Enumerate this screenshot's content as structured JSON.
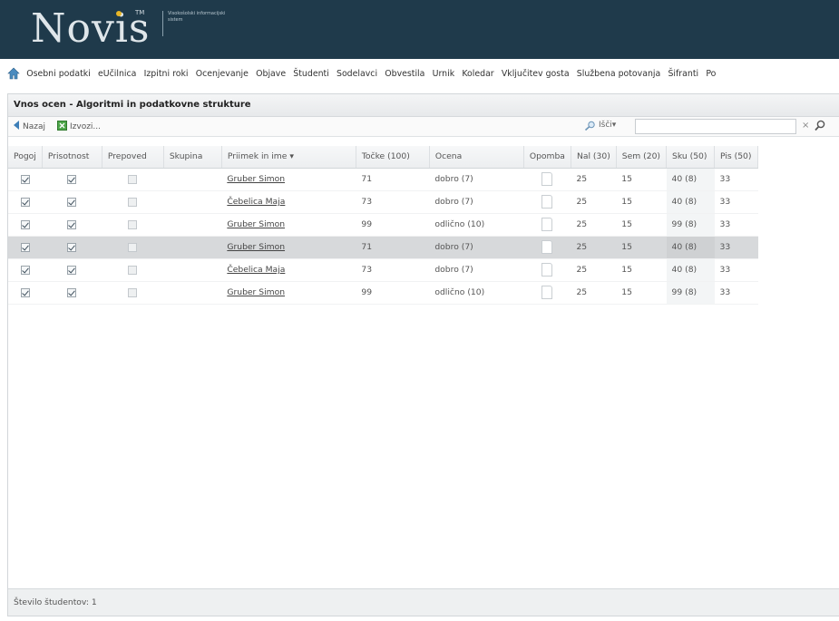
{
  "header": {
    "logo": "Novis",
    "trademark": "TM",
    "subtitle": "Visokošolski informacijski sistem"
  },
  "menu": {
    "items": [
      "Osebni podatki",
      "eUčilnica",
      "Izpitni roki",
      "Ocenjevanje",
      "Objave",
      "Študenti",
      "Sodelavci",
      "Obvestila",
      "Urnik",
      "Koledar",
      "Vključitev gosta",
      "Službena potovanja",
      "Šifranti",
      "Po"
    ]
  },
  "panel": {
    "title": "Vnos ocen - Algoritmi in podatkovne strukture"
  },
  "toolbar": {
    "back_label": "Nazaj",
    "export_label": "Izvozi...",
    "search_label": "Išči",
    "search_value": "",
    "clear_glyph": "×"
  },
  "table": {
    "columns": [
      "Pogoj",
      "Prisotnost",
      "Prepoved",
      "Skupina",
      "Priimek in ime ▾",
      "Točke (100)",
      "Ocena",
      "Opomba",
      "Nal (30)",
      "Sem (20)",
      "Sku (50)",
      "Pis (50)"
    ],
    "rows": [
      {
        "pogoj": true,
        "prisotnost": true,
        "prepoved": false,
        "skupina": "",
        "name": "Gruber Simon",
        "tocke": "71",
        "ocena": "dobro (7)",
        "nal": "25",
        "sem": "15",
        "sku": "40 (8)",
        "pis": "33",
        "selected": false
      },
      {
        "pogoj": true,
        "prisotnost": true,
        "prepoved": false,
        "skupina": "",
        "name": "Čebelica Maja",
        "tocke": "73",
        "ocena": "dobro (7)",
        "nal": "25",
        "sem": "15",
        "sku": "40 (8)",
        "pis": "33",
        "selected": false
      },
      {
        "pogoj": true,
        "prisotnost": true,
        "prepoved": false,
        "skupina": "",
        "name": "Gruber Simon",
        "tocke": "99",
        "ocena": "odlično (10)",
        "nal": "25",
        "sem": "15",
        "sku": "99 (8)",
        "pis": "33",
        "selected": false
      },
      {
        "pogoj": true,
        "prisotnost": true,
        "prepoved": false,
        "skupina": "",
        "name": "Gruber Simon",
        "tocke": "71",
        "ocena": "dobro (7)",
        "nal": "25",
        "sem": "15",
        "sku": "40 (8)",
        "pis": "33",
        "selected": true
      },
      {
        "pogoj": true,
        "prisotnost": true,
        "prepoved": false,
        "skupina": "",
        "name": "Čebelica Maja",
        "tocke": "73",
        "ocena": "dobro (7)",
        "nal": "25",
        "sem": "15",
        "sku": "40 (8)",
        "pis": "33",
        "selected": false
      },
      {
        "pogoj": true,
        "prisotnost": true,
        "prepoved": false,
        "skupina": "",
        "name": "Gruber Simon",
        "tocke": "99",
        "ocena": "odlično (10)",
        "nal": "25",
        "sem": "15",
        "sku": "99 (8)",
        "pis": "33",
        "selected": false
      }
    ]
  },
  "footer": {
    "student_count": "Število študentov: 1"
  },
  "colors": {
    "header_bg": "#1f3a4b",
    "logo_dot": "#e8b627",
    "selected_row": "#d7d9db"
  }
}
